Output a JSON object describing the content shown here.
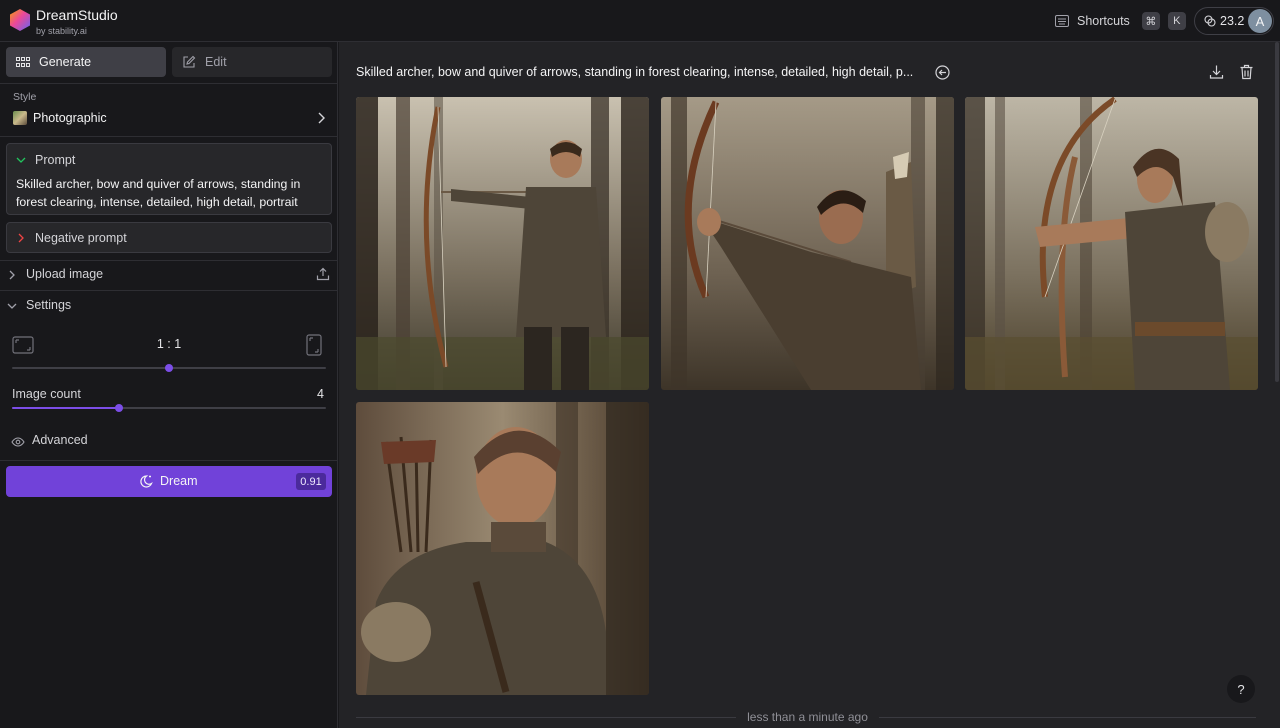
{
  "app": {
    "title": "DreamStudio",
    "subtitle": "by stability.ai"
  },
  "header": {
    "shortcuts_label": "Shortcuts",
    "shortcut_keys": [
      "⌘",
      "K"
    ],
    "credits": "23.2",
    "avatar_initial": "A"
  },
  "sidebar": {
    "tabs": [
      {
        "label": "Generate",
        "icon": "grid-icon",
        "active": true
      },
      {
        "label": "Edit",
        "icon": "edit-icon",
        "active": false
      }
    ],
    "style": {
      "caption": "Style",
      "value": "Photographic"
    },
    "prompt": {
      "title": "Prompt",
      "text": "Skilled archer, bow and quiver of arrows, standing in forest clearing, intense, detailed, high detail, portrait"
    },
    "negative_prompt": {
      "title": "Negative prompt"
    },
    "upload_image": {
      "label": "Upload image"
    },
    "settings": {
      "label": "Settings",
      "aspect_ratio": "1 : 1",
      "aspect_slider_level": 0.5,
      "image_count_label": "Image count",
      "image_count": "4",
      "image_count_slider_level": 0.34,
      "advanced_label": "Advanced"
    },
    "dream": {
      "label": "Dream",
      "cost": "0.91"
    }
  },
  "main": {
    "prompt_title": "Skilled archer, bow and quiver of arrows, standing in forest clearing, intense, detailed, high detail, p...",
    "timestamp": "less than a minute ago",
    "help_label": "?",
    "images": [
      {
        "name": "generated-image-1"
      },
      {
        "name": "generated-image-2"
      },
      {
        "name": "generated-image-3"
      },
      {
        "name": "generated-image-4"
      }
    ]
  },
  "colors": {
    "accent": "#7142d9",
    "background": "#18181b",
    "panel": "#232326",
    "input": "#27272a"
  }
}
